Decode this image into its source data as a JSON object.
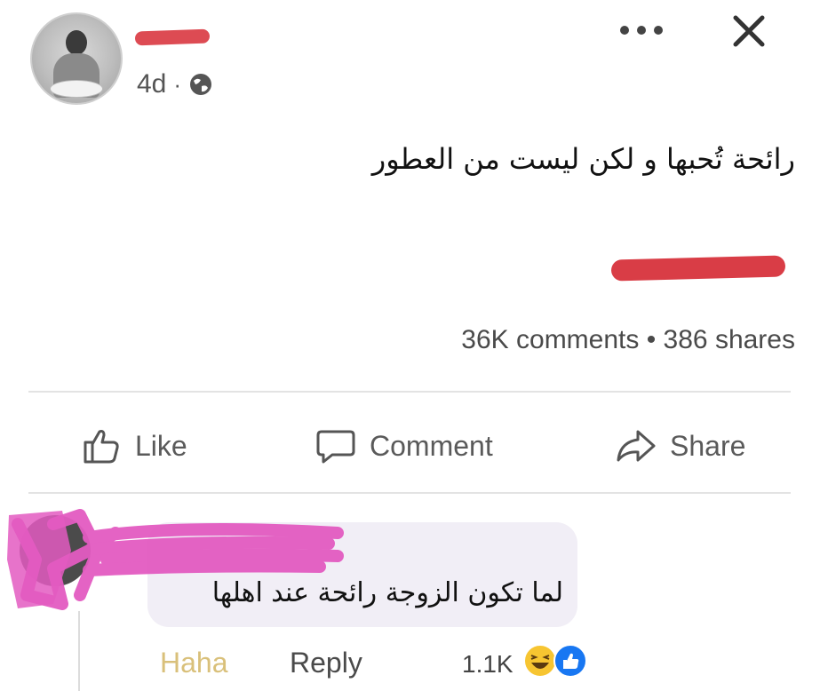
{
  "post": {
    "time": "4d",
    "separator": "·",
    "text": "رائحة تُحبها و لكن ليست من العطور",
    "stats": "36K comments • 386 shares"
  },
  "actions": {
    "like": "Like",
    "comment": "Comment",
    "share": "Share"
  },
  "comment": {
    "text": "لما تكون الزوجة رائحة عند اهلها",
    "haha": "Haha",
    "reply": "Reply",
    "reaction_count": "1.1K"
  },
  "icons": [
    "globe-icon",
    "more-icon",
    "close-icon",
    "like-icon",
    "comment-icon",
    "share-icon",
    "haha-icon",
    "like-reaction-icon"
  ],
  "colors": {
    "redaction_red": "#dd4b53",
    "redaction_pink": "#e35bc1",
    "haha_label": "#d9c07a",
    "like_blue": "#1877f2",
    "haha_yellow": "#f7c531"
  }
}
